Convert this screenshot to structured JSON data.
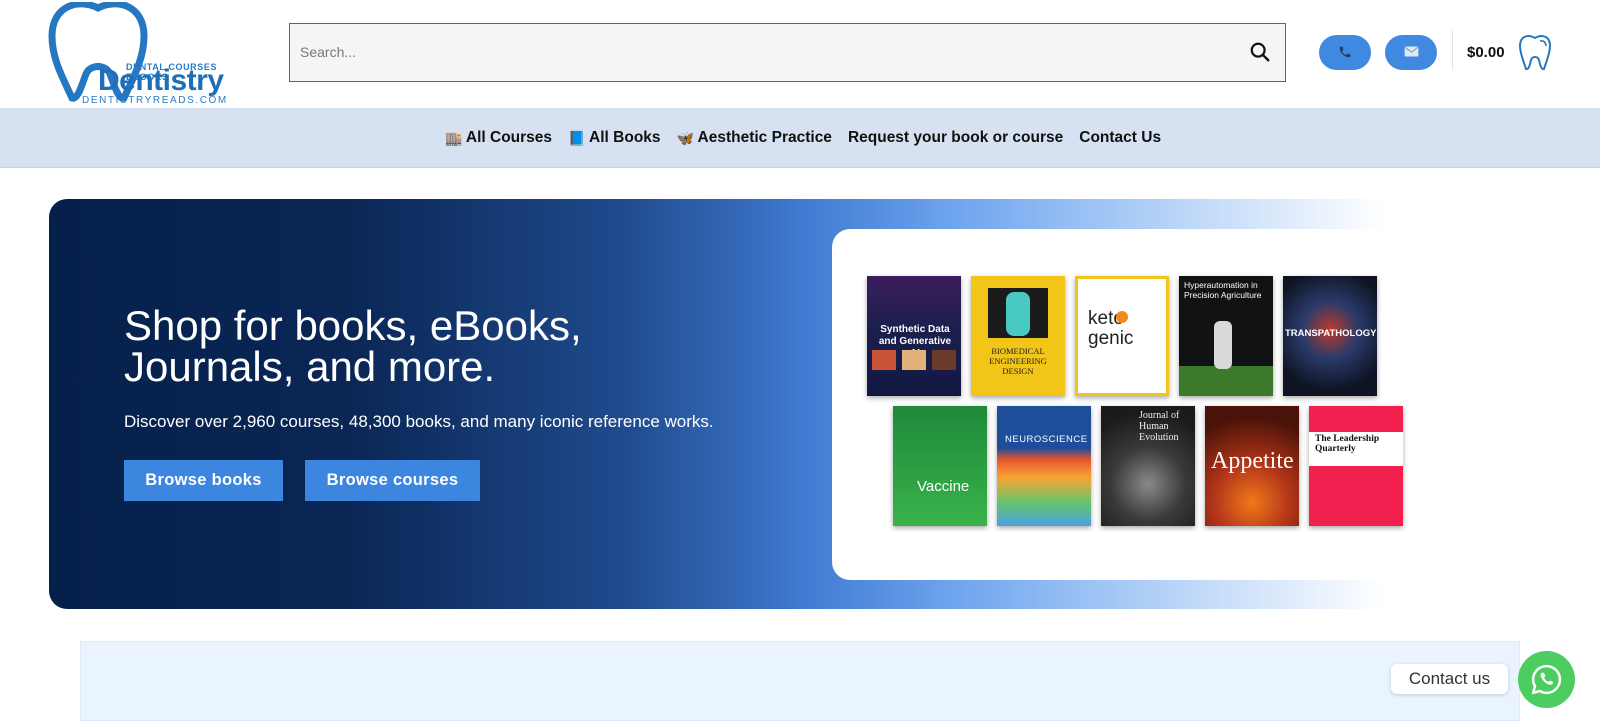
{
  "header": {
    "logo": {
      "tagline": "DENTAL COURSES EBOOKS",
      "brand": "Dentistry",
      "site": "DENTISTRYREADS.COM"
    },
    "search": {
      "placeholder": "Search..."
    },
    "cart_total": "$0.00",
    "icons": [
      "phone-icon",
      "mail-icon",
      "search-icon",
      "tooth-cart-icon"
    ]
  },
  "nav": {
    "items": [
      {
        "emoji": "🏬",
        "label": "All Courses"
      },
      {
        "emoji": "📘",
        "label": "All Books"
      },
      {
        "emoji": "🦋",
        "label": "Aesthetic Practice"
      },
      {
        "emoji": "",
        "label": "Request your book or course"
      },
      {
        "emoji": "",
        "label": "Contact Us"
      }
    ]
  },
  "hero": {
    "heading": "Shop for books, eBooks, Journals, and more.",
    "subtext": "Discover over 2,960 courses, 48,300 books, and many iconic reference works.",
    "buttons": {
      "books": "Browse books",
      "courses": "Browse courses"
    },
    "books": [
      {
        "title": "Synthetic Data and Generative AI",
        "color": "#141b46"
      },
      {
        "title": "BIOMEDICAL ENGINEERING DESIGN",
        "color": "#f2c619"
      },
      {
        "title": "keto genic",
        "color": "#ffffff"
      },
      {
        "title": "Hyperautomation in Precision Agriculture",
        "color": "#101214"
      },
      {
        "title": "TRANSPATHOLOGY",
        "color": "#0f1424"
      },
      {
        "title": "Vaccine",
        "color": "#1e8a3a"
      },
      {
        "title": "NEUROSCIENCE",
        "color": "#1d4e9c"
      },
      {
        "title": "Journal of Human Evolution",
        "color": "#2a2a2a"
      },
      {
        "title": "Appetite",
        "color": "#6a1d10"
      },
      {
        "title": "The Leadership Quarterly",
        "color": "#f2204f"
      }
    ]
  },
  "contact_widget": {
    "label": "Contact us"
  }
}
